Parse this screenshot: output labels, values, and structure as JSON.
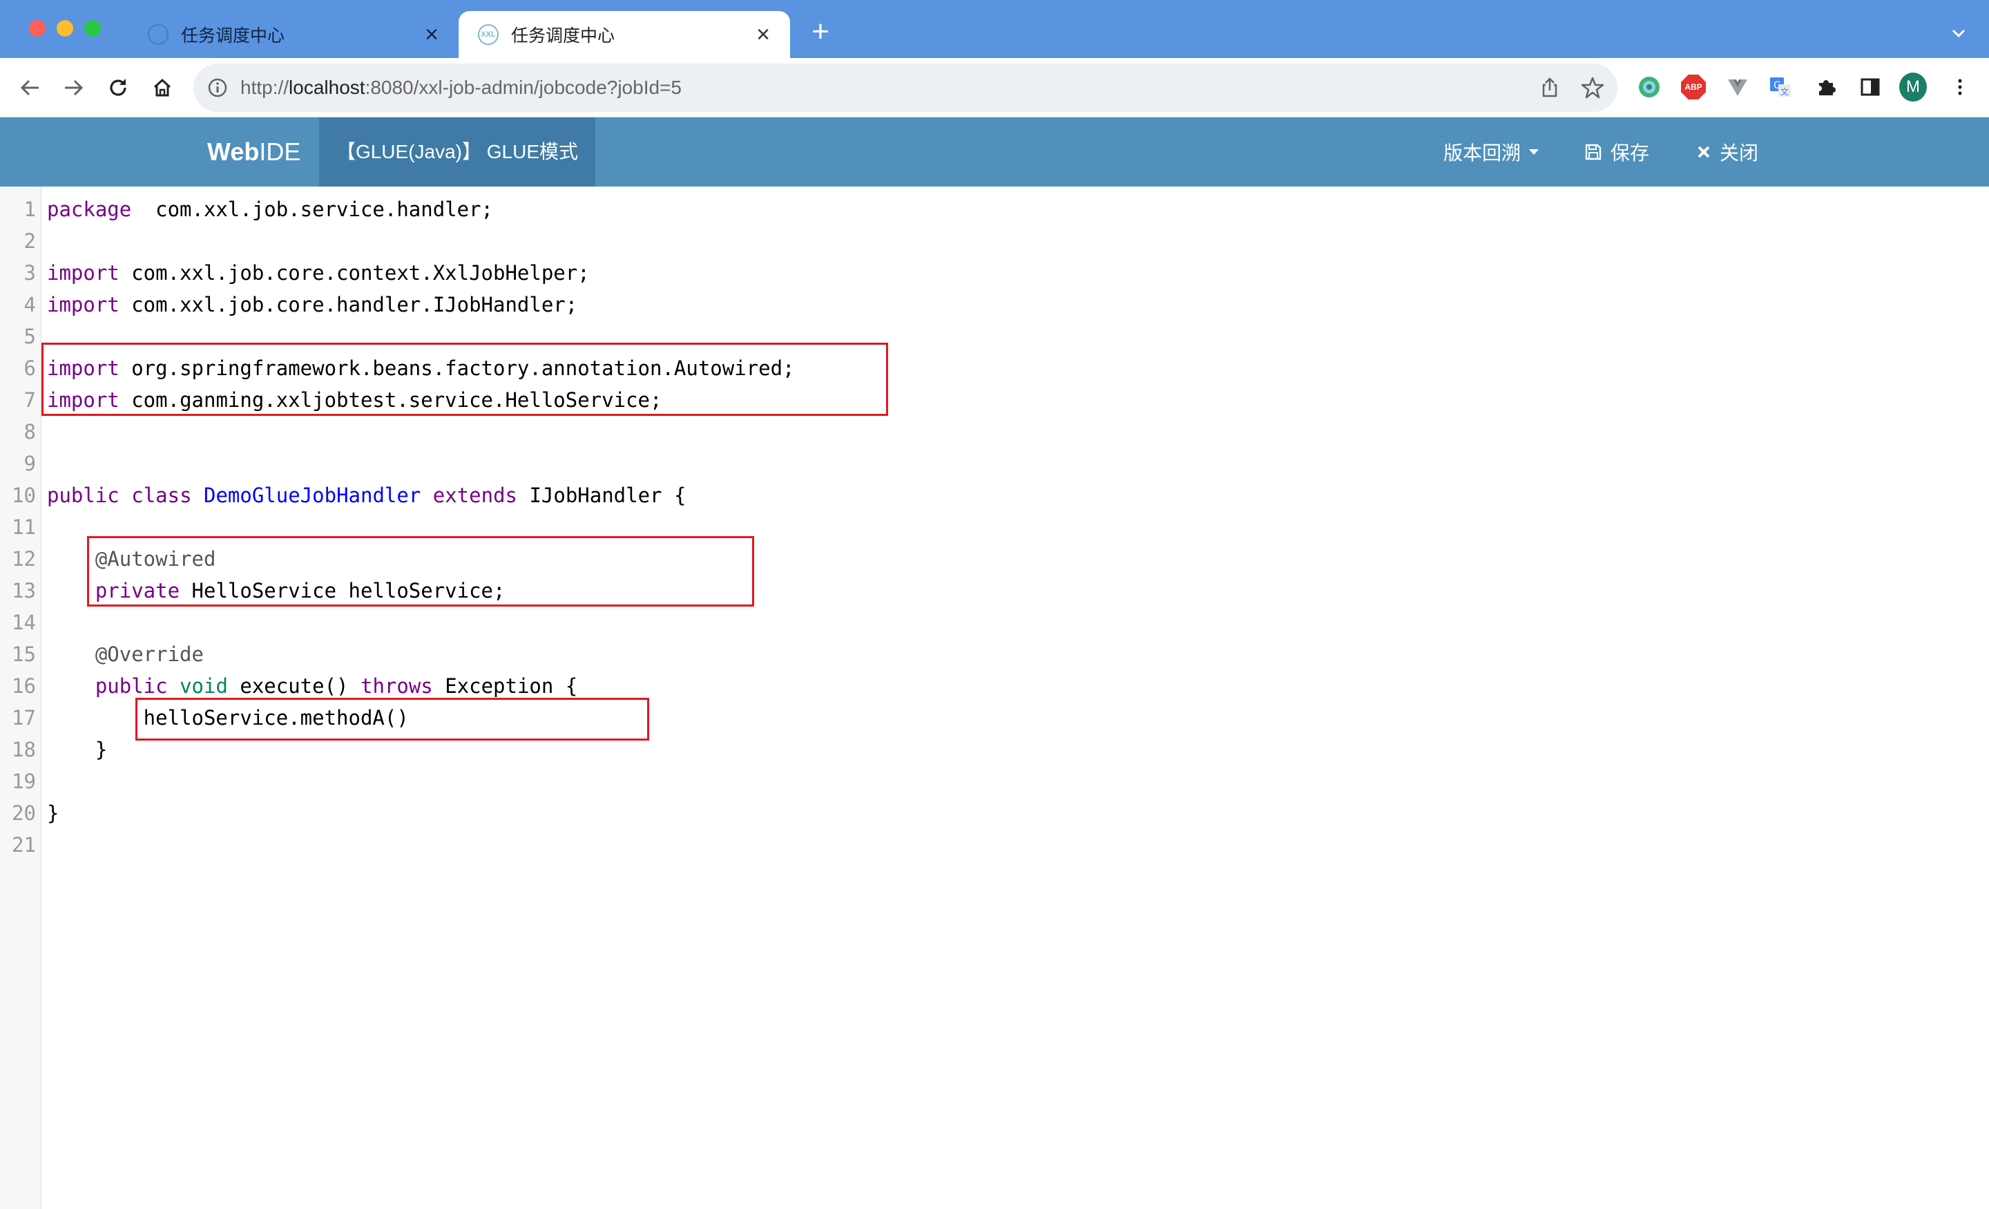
{
  "browser": {
    "tabs": [
      {
        "title": "任务调度中心",
        "active": false,
        "favicon": "xxl-favicon-icon"
      },
      {
        "title": "任务调度中心",
        "active": true,
        "favicon": "xxl-favicon-icon",
        "favicon_text": "XXL"
      }
    ],
    "close_glyph": "×",
    "new_tab_glyph": "+",
    "url": {
      "scheme": "http://",
      "host": "localhost",
      "rest": ":8080/xxl-job-admin/jobcode?jobId=5"
    },
    "profile_initial": "M",
    "extensions": [
      "color-wheel-icon",
      "adblock-icon",
      "vue-devtools-icon",
      "translate-icon",
      "puzzle-extensions-icon",
      "side-panel-icon"
    ],
    "abp_text": "ABP"
  },
  "ide": {
    "logo_bold": "Web",
    "logo_rest": "IDE",
    "mode": "【GLUE(Java)】 GLUE模式",
    "versions": "版本回溯",
    "save": "保存",
    "close": "关闭"
  },
  "editor": {
    "lines": [
      {
        "n": "1",
        "tokens": [
          [
            "kw",
            "package"
          ],
          [
            "",
            "  com.xxl.job.service.handler;"
          ]
        ]
      },
      {
        "n": "2",
        "tokens": []
      },
      {
        "n": "3",
        "tokens": [
          [
            "kw",
            "import"
          ],
          [
            "",
            " com.xxl.job.core.context.XxlJobHelper;"
          ]
        ]
      },
      {
        "n": "4",
        "tokens": [
          [
            "kw",
            "import"
          ],
          [
            "",
            " com.xxl.job.core.handler.IJobHandler;"
          ]
        ]
      },
      {
        "n": "5",
        "tokens": []
      },
      {
        "n": "6",
        "tokens": [
          [
            "kw",
            "import"
          ],
          [
            "",
            " org.springframework.beans.factory.annotation.Autowired;"
          ]
        ]
      },
      {
        "n": "7",
        "tokens": [
          [
            "kw",
            "import"
          ],
          [
            "",
            " com.ganming.xxljobtest.service.HelloService;"
          ]
        ]
      },
      {
        "n": "8",
        "tokens": []
      },
      {
        "n": "9",
        "tokens": []
      },
      {
        "n": "10",
        "tokens": [
          [
            "kw",
            "public"
          ],
          [
            "",
            " "
          ],
          [
            "kw",
            "class"
          ],
          [
            "",
            " "
          ],
          [
            "def",
            "DemoGlueJobHandler"
          ],
          [
            "",
            " "
          ],
          [
            "kw",
            "extends"
          ],
          [
            "",
            " IJobHandler {"
          ]
        ]
      },
      {
        "n": "11",
        "tokens": []
      },
      {
        "n": "12",
        "tokens": [
          [
            "",
            "    "
          ],
          [
            "meta",
            "@Autowired"
          ]
        ]
      },
      {
        "n": "13",
        "tokens": [
          [
            "",
            "    "
          ],
          [
            "kw",
            "private"
          ],
          [
            "",
            " HelloService helloService;"
          ]
        ]
      },
      {
        "n": "14",
        "tokens": []
      },
      {
        "n": "15",
        "tokens": [
          [
            "",
            "    "
          ],
          [
            "meta",
            "@Override"
          ]
        ]
      },
      {
        "n": "16",
        "tokens": [
          [
            "",
            "    "
          ],
          [
            "kw",
            "public"
          ],
          [
            "",
            " "
          ],
          [
            "type",
            "void"
          ],
          [
            "",
            " execute() "
          ],
          [
            "kw",
            "throws"
          ],
          [
            "",
            " Exception {"
          ]
        ]
      },
      {
        "n": "17",
        "tokens": [
          [
            "",
            "        helloService.methodA()"
          ]
        ]
      },
      {
        "n": "18",
        "tokens": [
          [
            "",
            "    }"
          ]
        ]
      },
      {
        "n": "19",
        "tokens": []
      },
      {
        "n": "20",
        "tokens": [
          [
            "",
            "}"
          ]
        ]
      },
      {
        "n": "21",
        "tokens": []
      }
    ]
  },
  "highlight_color": "#e0191f"
}
